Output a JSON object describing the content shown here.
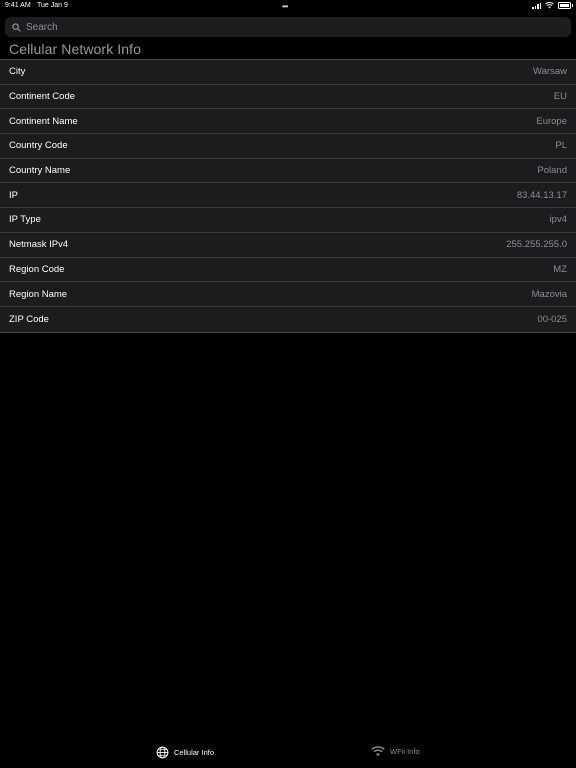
{
  "status_bar": {
    "time": "9:41 AM",
    "date": "Tue Jan 9",
    "multitask_indicator": "•••"
  },
  "search": {
    "placeholder": "Search"
  },
  "page": {
    "title": "Cellular Network Info"
  },
  "rows": [
    {
      "label": "City",
      "value": "Warsaw"
    },
    {
      "label": "Continent Code",
      "value": "EU"
    },
    {
      "label": "Continent Name",
      "value": "Europe"
    },
    {
      "label": "Country Code",
      "value": "PL"
    },
    {
      "label": "Country Name",
      "value": "Poland"
    },
    {
      "label": "IP",
      "value": "83.44.13.17"
    },
    {
      "label": "IP Type",
      "value": "ipv4"
    },
    {
      "label": "Netmask IPv4",
      "value": "255.255.255.0"
    },
    {
      "label": "Region Code",
      "value": "MZ"
    },
    {
      "label": "Region Name",
      "value": "Mazovia"
    },
    {
      "label": "ZIP Code",
      "value": "00-025"
    }
  ],
  "tab_bar": {
    "tabs": [
      {
        "label": "Cellular Info",
        "icon": "globe-icon",
        "selected": true
      },
      {
        "label": "WFii Info",
        "icon": "wifi-icon",
        "selected": false
      }
    ]
  },
  "colors": {
    "background": "#000000",
    "cell_background": "#1c1c1e",
    "separator": "#3a3a3c",
    "secondary_text": "#8e8e93",
    "search_background": "#1d1d1f"
  }
}
